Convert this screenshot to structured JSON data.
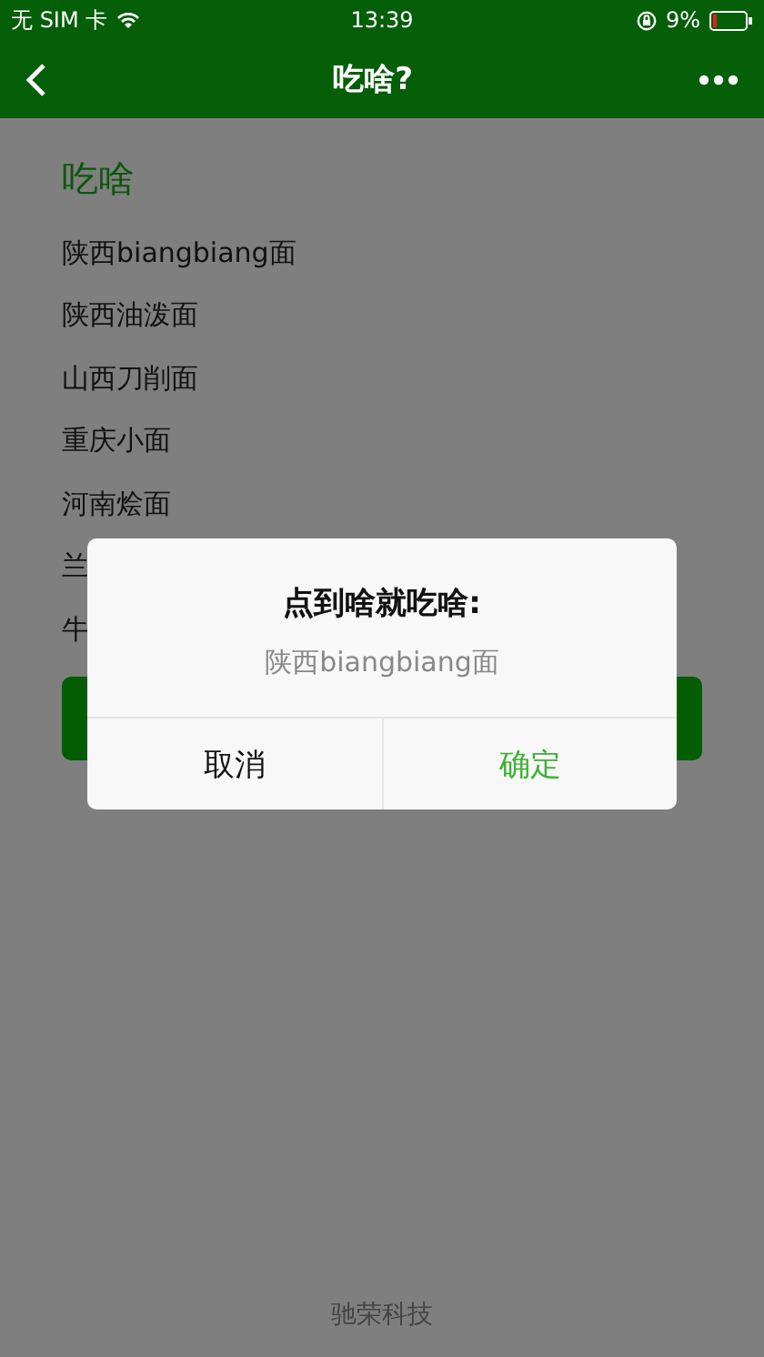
{
  "status_bar": {
    "carrier": "无 SIM 卡",
    "time": "13:39",
    "battery": "9%"
  },
  "nav_bar": {
    "title": "吃啥?"
  },
  "section_title": "吃啥",
  "items": [
    "陕西biangbiang面",
    "陕西油泼面",
    "山西刀削面",
    "重庆小面",
    "河南烩面",
    "兰",
    "牛"
  ],
  "footer": "驰荣科技",
  "dialog": {
    "title": "点到啥就吃啥:",
    "message": "陕西biangbiang面",
    "buttons": [
      {
        "label": "取消",
        "kind": "cancel"
      },
      {
        "label": "确定",
        "kind": "confirm"
      }
    ]
  }
}
